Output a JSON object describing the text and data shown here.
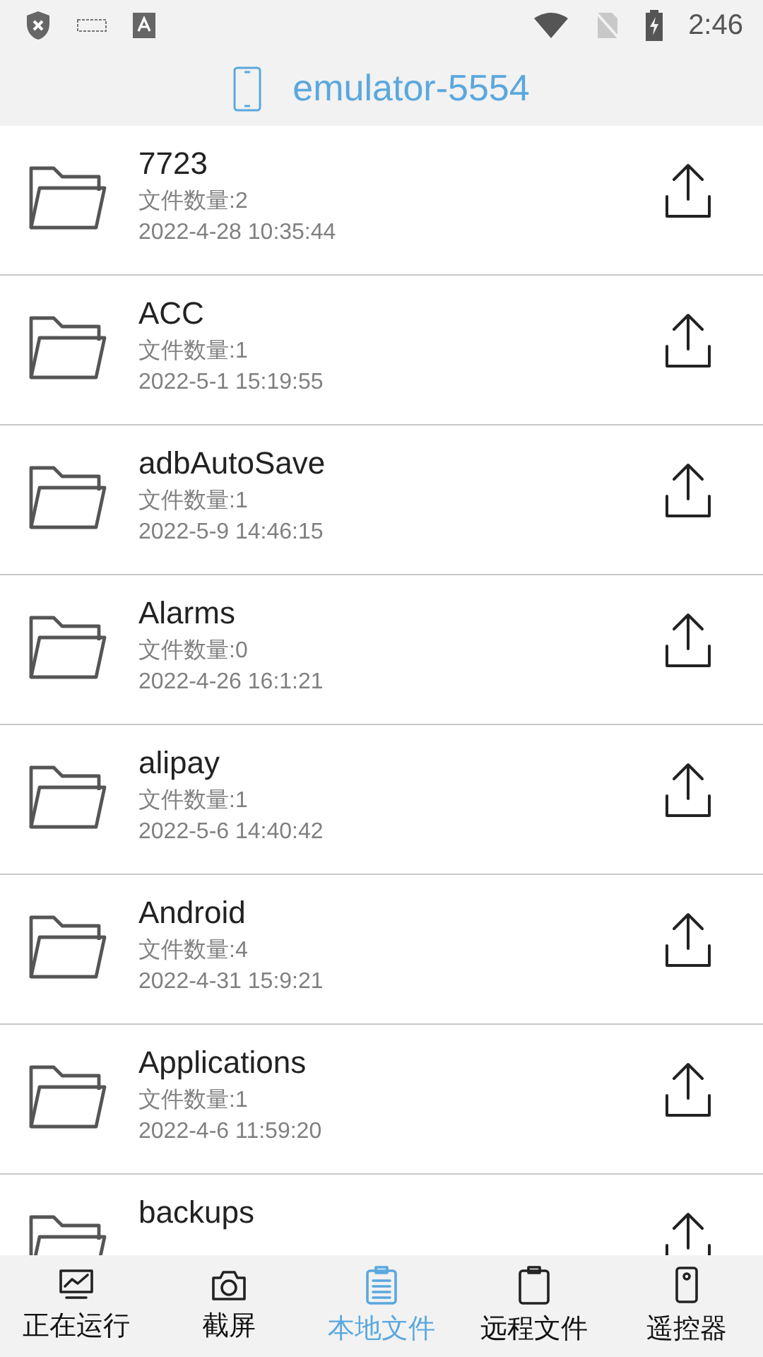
{
  "status_bar": {
    "time": "2:46"
  },
  "header": {
    "title": "emulator-5554"
  },
  "files": [
    {
      "name": "7723",
      "count": "文件数量:2",
      "date": "2022-4-28 10:35:44"
    },
    {
      "name": "ACC",
      "count": "文件数量:1",
      "date": "2022-5-1 15:19:55"
    },
    {
      "name": "adbAutoSave",
      "count": "文件数量:1",
      "date": "2022-5-9 14:46:15"
    },
    {
      "name": "Alarms",
      "count": "文件数量:0",
      "date": "2022-4-26 16:1:21"
    },
    {
      "name": "alipay",
      "count": "文件数量:1",
      "date": "2022-5-6 14:40:42"
    },
    {
      "name": "Android",
      "count": "文件数量:4",
      "date": "2022-4-31 15:9:21"
    },
    {
      "name": "Applications",
      "count": "文件数量:1",
      "date": "2022-4-6 11:59:20"
    },
    {
      "name": "backups"
    }
  ],
  "nav": [
    {
      "kind": "chart",
      "label": "正在运行",
      "selected": false
    },
    {
      "kind": "camera",
      "label": "截屏",
      "selected": false
    },
    {
      "kind": "clipboard",
      "label": "本地文件",
      "selected": true
    },
    {
      "kind": "remote",
      "label": "远程文件",
      "selected": false
    },
    {
      "kind": "remote-control",
      "label": "遥控器",
      "selected": false
    }
  ]
}
